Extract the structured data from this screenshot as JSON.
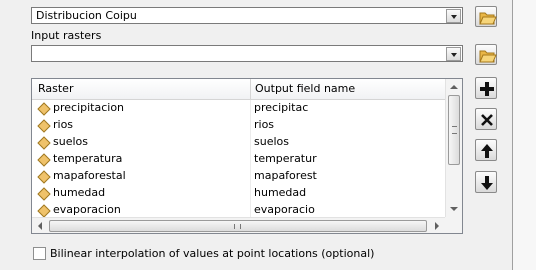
{
  "feature_input": {
    "value": "Distribucion Coipu"
  },
  "rasters_section": {
    "label": "Input rasters",
    "value": ""
  },
  "table": {
    "headers": {
      "raster": "Raster",
      "field": "Output field name"
    },
    "rows": [
      {
        "raster": "precipitacion",
        "field": "precipitac"
      },
      {
        "raster": "rios",
        "field": "rios"
      },
      {
        "raster": "suelos",
        "field": "suelos"
      },
      {
        "raster": "temperatura",
        "field": "temperatur"
      },
      {
        "raster": "mapaforestal",
        "field": "mapaforest"
      },
      {
        "raster": "humedad",
        "field": "humedad"
      },
      {
        "raster": "evaporacion",
        "field": "evaporacio"
      }
    ]
  },
  "interpolation_option": {
    "label": "Bilinear interpolation of values at  point locations (optional)",
    "checked": false
  },
  "icons": {
    "folder": "folder-open-icon",
    "raster": "raster-layer-icon",
    "add": "plus-icon",
    "remove": "x-icon",
    "up": "arrow-up-icon",
    "down": "arrow-down-icon"
  }
}
